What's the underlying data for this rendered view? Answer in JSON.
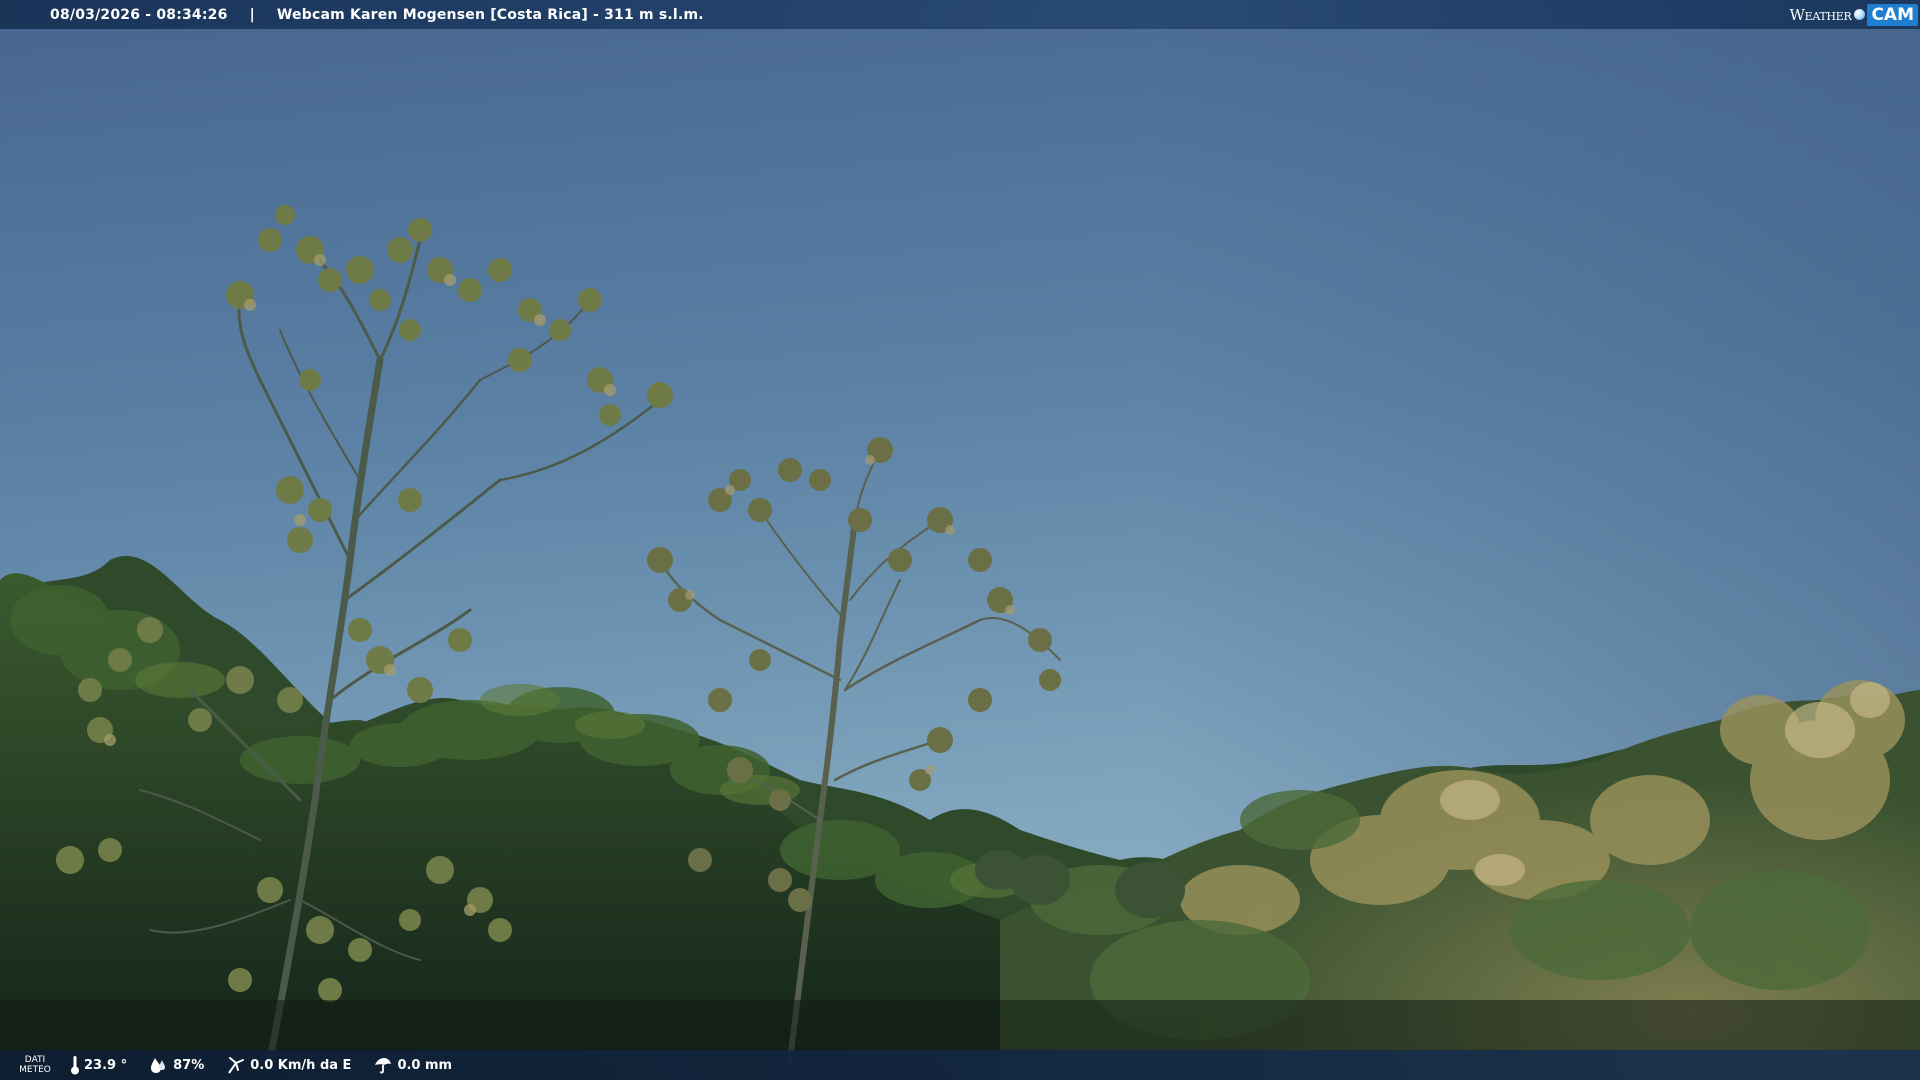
{
  "header": {
    "datetime": "08/03/2026 - 08:34:26",
    "separator": "|",
    "title": "Webcam Karen Mogensen [Costa Rica] - 311 m s.l.m.",
    "brand_weather": "Weather",
    "brand_cam": "CAM"
  },
  "weather_bar": {
    "label_line1": "DATI",
    "label_line2": "METEO",
    "temperature": "23.9 °",
    "humidity": "87%",
    "wind": "0.0 Km/h da E",
    "rain": "0.0 mm"
  },
  "icons": {
    "temperature": "thermometer-icon",
    "humidity": "humidity-drop-icon",
    "wind": "wind-icon",
    "rain": "rain-icon",
    "logo_dot": "weathercam-logo-dot-icon"
  },
  "colors": {
    "sky_top": "#4a6890",
    "sky_bottom": "#86aac0",
    "foliage_dark": "#1f3220",
    "foliage_mid": "#3e5a2c",
    "foliage_light": "#8e8a54",
    "bar_bg": "#1b3a62",
    "brand_blue": "#1f7ed0"
  }
}
